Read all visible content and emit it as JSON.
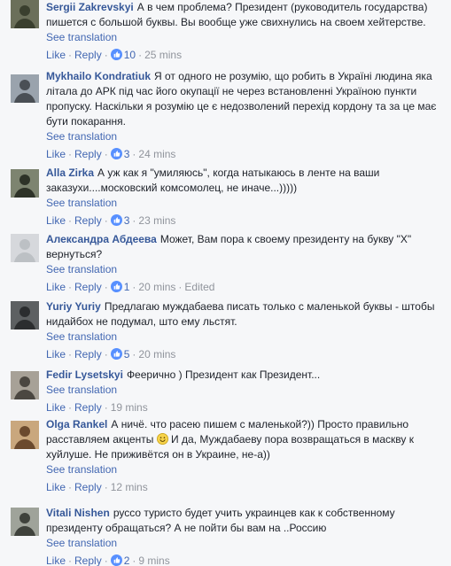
{
  "comments": [
    {
      "author": "Sergii Zakrevskyi",
      "text": "А в чем проблема? Президент (руководитель государства) пишется с большой буквы. Вы вообще уже свихнулись на своем хейтерстве.",
      "see_translation": "See translation",
      "like": "Like",
      "reply": "Reply",
      "likes": "10",
      "time": "25 mins",
      "avatar_colors": [
        "#6b6f5a",
        "#3a3f2e"
      ]
    },
    {
      "author": "Mykhailo Kondratiuk",
      "text": "Я от одного не розумію, що робить в Україні людина яка літала до АРК під час його окупації не через встановленні Україною пункти пропуску. Наскільки я розумію це є недозволений перехід кордону та за це має бути покарання.",
      "see_translation": "See translation",
      "like": "Like",
      "reply": "Reply",
      "likes": "3",
      "time": "24 mins",
      "avatar_colors": [
        "#9aa3ad",
        "#4a4f55"
      ]
    },
    {
      "author": "Alla Zirka",
      "text": "А уж как я \"умиляюсь\", когда натыкаюсь в ленте на ваши заказухи....московский комсомолец, не иначе...)))))",
      "see_translation": "See translation",
      "like": "Like",
      "reply": "Reply",
      "likes": "3",
      "time": "23 mins",
      "avatar_colors": [
        "#7d8470",
        "#2e3328"
      ]
    },
    {
      "author": "Александра Абдеева",
      "text": "Может, Вам пора к своему президенту на букву \"Х\" вернуться?",
      "see_translation": "See translation",
      "like": "Like",
      "reply": "Reply",
      "likes": "1",
      "time": "20 mins",
      "edited": "Edited",
      "avatar_colors": [
        "#d6d8dc",
        "#bcc0c4"
      ]
    },
    {
      "author": "Yuriy Yuriy",
      "text": "Предлагаю муждабаева писать только с маленькой буквы - штобы нидайбох не подумал, што ему льстят.",
      "see_translation": "See translation",
      "like": "Like",
      "reply": "Reply",
      "likes": "5",
      "time": "20 mins",
      "avatar_colors": [
        "#5d6062",
        "#2b2d2f"
      ]
    },
    {
      "author": "Fedir Lysetskyi",
      "text": "Феерично ) Президент как Президент...",
      "see_translation": "See translation",
      "like": "Like",
      "reply": "Reply",
      "time": "19 mins",
      "avatar_colors": [
        "#a7a197",
        "#4b4741"
      ]
    },
    {
      "author": "Olga Rankel",
      "text_before_emoji": "А ничё. что расею пишем с маленькой?)) Просто правильно расставляем акценты",
      "text_after_emoji": "И да, Муждабаеву пора возвращаться в маскву к хуйлуше. Не приживётся он в Украине, не-а))",
      "see_translation": "See translation",
      "like": "Like",
      "reply": "Reply",
      "time": "12 mins",
      "avatar_colors": [
        "#c9a77d",
        "#6b4a2e"
      ]
    },
    {
      "author": "Vitali Nishen",
      "text": "руссо туристо будет учить украинцев как к собственному президенту обращаться? А не пойти бы вам на ..Россию",
      "see_translation": "See translation",
      "like": "Like",
      "reply": "Reply",
      "likes": "2",
      "time": "9 mins",
      "avatar_colors": [
        "#9fa39a",
        "#3f423c"
      ]
    }
  ],
  "colors": {
    "name": "#365899",
    "link": "#4267b2",
    "meta": "#90949c",
    "text": "#1d2129",
    "background": "#f6f7f9"
  }
}
